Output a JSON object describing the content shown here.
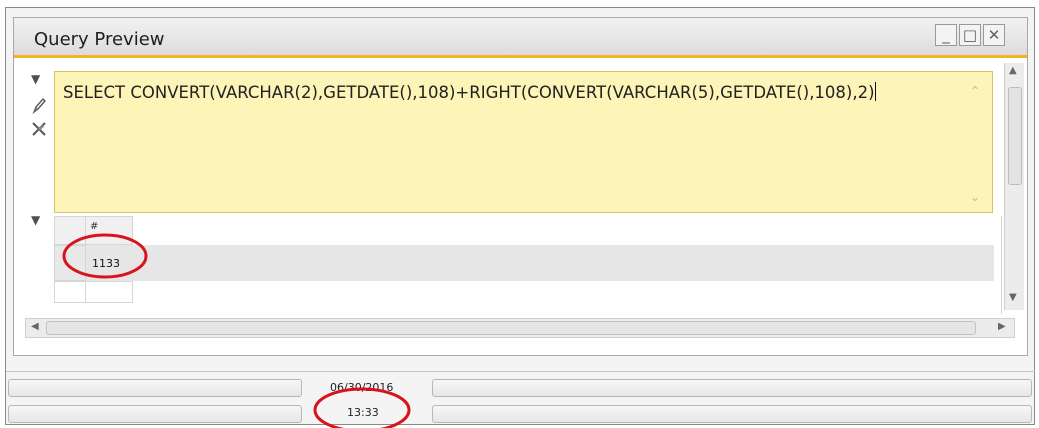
{
  "window": {
    "title": "Query Preview",
    "buttons": {
      "minimize": "_",
      "maximize": "□",
      "close": "✕"
    }
  },
  "editor": {
    "sql": "SELECT CONVERT(VARCHAR(2),GETDATE(),108)+RIGHT(CONVERT(VARCHAR(5),GETDATE(),108),2)",
    "background": "#fdf4b7"
  },
  "result": {
    "header": "#",
    "rows": [
      {
        "value": "1133"
      }
    ]
  },
  "statusbar": {
    "date": "06/30/2016",
    "time": "13:33"
  },
  "icons": {
    "toggle_editor": "triangle-down-icon",
    "edit": "pencil-icon",
    "clear": "eraser-icon",
    "toggle_result": "triangle-down-icon",
    "scroll_up": "arrow-up-icon",
    "scroll_down": "arrow-down-icon",
    "scroll_left": "arrow-left-icon",
    "scroll_right": "arrow-right-icon"
  },
  "colors": {
    "accent": "#f5b320",
    "highlight_circle": "#d8131b"
  }
}
